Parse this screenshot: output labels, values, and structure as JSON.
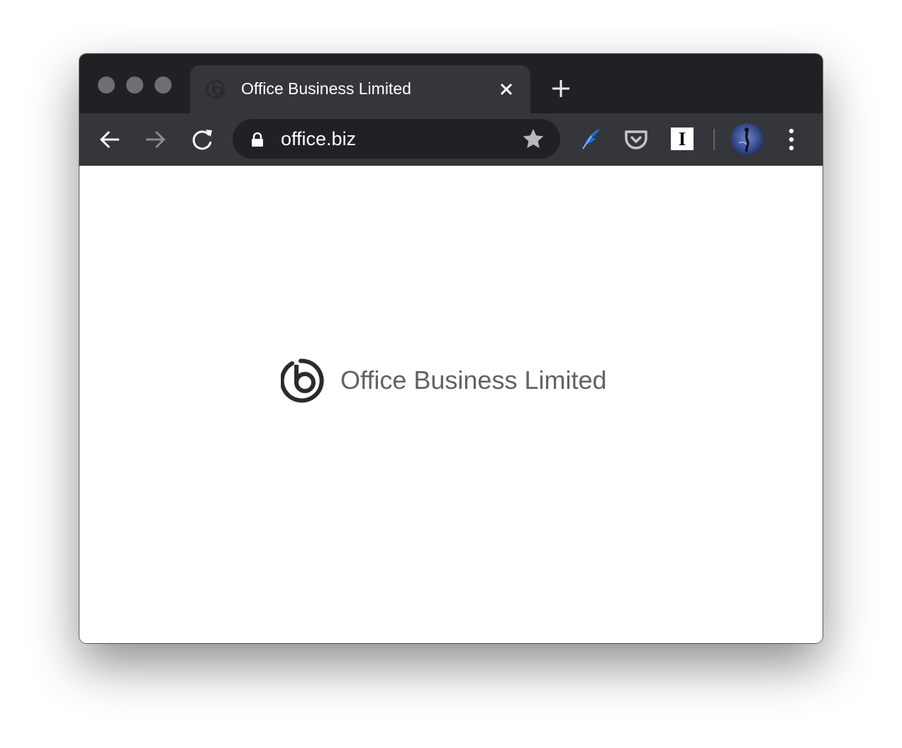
{
  "browser": {
    "tab": {
      "title": "Office Business Limited",
      "favicon": "office-business-logo-icon"
    },
    "address_bar": {
      "url": "office.biz",
      "secure": true
    },
    "extensions": [
      "flow-feather-extension-icon",
      "pocket-icon",
      "instapaper-icon"
    ],
    "instapaper_letter": "I",
    "colors": {
      "titlebar": "#202124",
      "toolbar": "#35363a",
      "omnibox": "#202124",
      "page_text": "#5f6368",
      "logo": "#2b2b2b"
    }
  },
  "page": {
    "logo_text": "Office Business Limited"
  }
}
